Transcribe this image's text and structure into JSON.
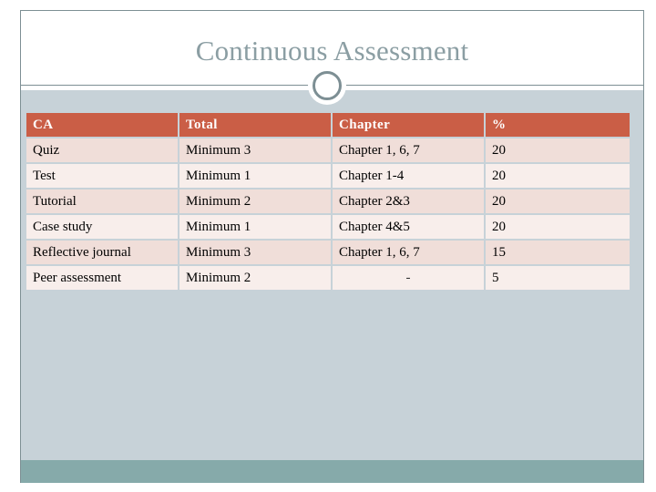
{
  "slide": {
    "title": "Continuous Assessment",
    "decoration": "ring-divider",
    "colors": {
      "title_text": "#8b9ea3",
      "frame_border": "#7d8f94",
      "panel_background": "#c7d2d8",
      "footer_band": "#86aaaa",
      "table_header_background": "#ca5e46",
      "table_header_text": "#ffffff",
      "row_odd_background": "#f0ded9",
      "row_even_background": "#f8eeeb"
    }
  },
  "table": {
    "headers": [
      "CA",
      "Total",
      "Chapter",
      "%"
    ],
    "rows": [
      {
        "ca": "Quiz",
        "total": "Minimum 3",
        "chapter": "Chapter 1, 6, 7",
        "percent": "20"
      },
      {
        "ca": "Test",
        "total": "Minimum 1",
        "chapter": "Chapter 1-4",
        "percent": "20"
      },
      {
        "ca": "Tutorial",
        "total": "Minimum 2",
        "chapter": "Chapter 2&3",
        "percent": "20"
      },
      {
        "ca": "Case study",
        "total": "Minimum 1",
        "chapter": "Chapter 4&5",
        "percent": "20"
      },
      {
        "ca": "Reflective journal",
        "total": "Minimum 3",
        "chapter": "Chapter 1, 6, 7",
        "percent": "15"
      },
      {
        "ca": "Peer assessment",
        "total": "Minimum 2",
        "chapter": "-",
        "percent": "5"
      }
    ]
  }
}
